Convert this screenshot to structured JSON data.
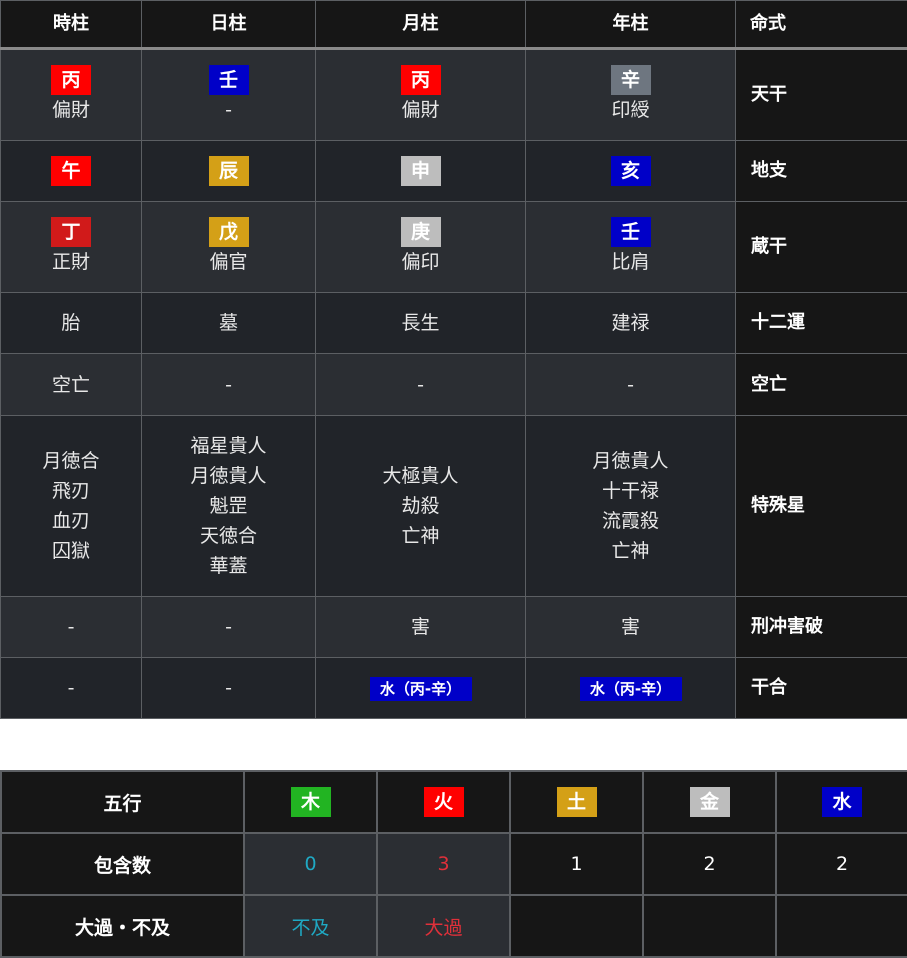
{
  "header": [
    "時柱",
    "日柱",
    "月柱",
    "年柱",
    "命式"
  ],
  "colors": {
    "red": "#ff0000",
    "dark_red": "#d11a1a",
    "blue": "#0000c8",
    "gold": "#d4a017",
    "gray": "#6e7680",
    "silver": "#bdbdbd",
    "green": "#22b422",
    "cyan": "#1fa9c4",
    "crimson": "#e0303a"
  },
  "rows": {
    "tenkan": {
      "label": "天干",
      "cells": [
        {
          "badge": "丙",
          "badge_color": "#ff0000",
          "sub": "偏財"
        },
        {
          "badge": "壬",
          "badge_color": "#0000c8",
          "sub": "-"
        },
        {
          "badge": "丙",
          "badge_color": "#ff0000",
          "sub": "偏財"
        },
        {
          "badge": "辛",
          "badge_color": "#6e7680",
          "sub": "印綬"
        }
      ]
    },
    "chishi": {
      "label": "地支",
      "cells": [
        {
          "badge": "午",
          "badge_color": "#ff0000"
        },
        {
          "badge": "辰",
          "badge_color": "#d4a017"
        },
        {
          "badge": "申",
          "badge_color": "#bdbdbd"
        },
        {
          "badge": "亥",
          "badge_color": "#0000c8"
        }
      ]
    },
    "zoukan": {
      "label": "蔵干",
      "cells": [
        {
          "badge": "丁",
          "badge_color": "#d11a1a",
          "sub": "正財"
        },
        {
          "badge": "戊",
          "badge_color": "#d4a017",
          "sub": "偏官"
        },
        {
          "badge": "庚",
          "badge_color": "#bdbdbd",
          "sub": "偏印"
        },
        {
          "badge": "壬",
          "badge_color": "#0000c8",
          "sub": "比肩"
        }
      ]
    },
    "juniun": {
      "label": "十二運",
      "values": [
        "胎",
        "墓",
        "長生",
        "建禄"
      ]
    },
    "kubou": {
      "label": "空亡",
      "values": [
        "空亡",
        "-",
        "-",
        "-"
      ]
    },
    "tokushusei": {
      "label": "特殊星",
      "values": [
        [
          "月徳合",
          "飛刃",
          "血刃",
          "囚獄"
        ],
        [
          "福星貴人",
          "月徳貴人",
          "魁罡",
          "天徳合",
          "華蓋"
        ],
        [
          "大極貴人",
          "劫殺",
          "亡神"
        ],
        [
          "月徳貴人",
          "十干禄",
          "流霞殺",
          "亡神"
        ]
      ]
    },
    "keichu": {
      "label": "刑冲害破",
      "values": [
        "-",
        "-",
        "害",
        "害"
      ]
    },
    "kangou": {
      "label": "干合",
      "values": [
        "-",
        "-",
        "水（丙-辛）",
        "水（丙-辛）"
      ]
    }
  },
  "gogyo": {
    "label": "五行",
    "elements": [
      {
        "name": "木",
        "color": "#22b422"
      },
      {
        "name": "火",
        "color": "#ff0000"
      },
      {
        "name": "土",
        "color": "#d4a017"
      },
      {
        "name": "金",
        "color": "#bdbdbd"
      },
      {
        "name": "水",
        "color": "#0000c8"
      }
    ],
    "count_label": "包含数",
    "counts": [
      "0",
      "3",
      "1",
      "2",
      "2"
    ],
    "count_colors": [
      "#1fa9c4",
      "#e0303a",
      "#ffffff",
      "#ffffff",
      "#ffffff"
    ],
    "excess_label": "大過・不及",
    "excess": [
      "不及",
      "大過",
      "",
      "",
      ""
    ],
    "excess_colors": [
      "#1fa9c4",
      "#e0303a",
      "#ffffff",
      "#ffffff",
      "#ffffff"
    ]
  }
}
